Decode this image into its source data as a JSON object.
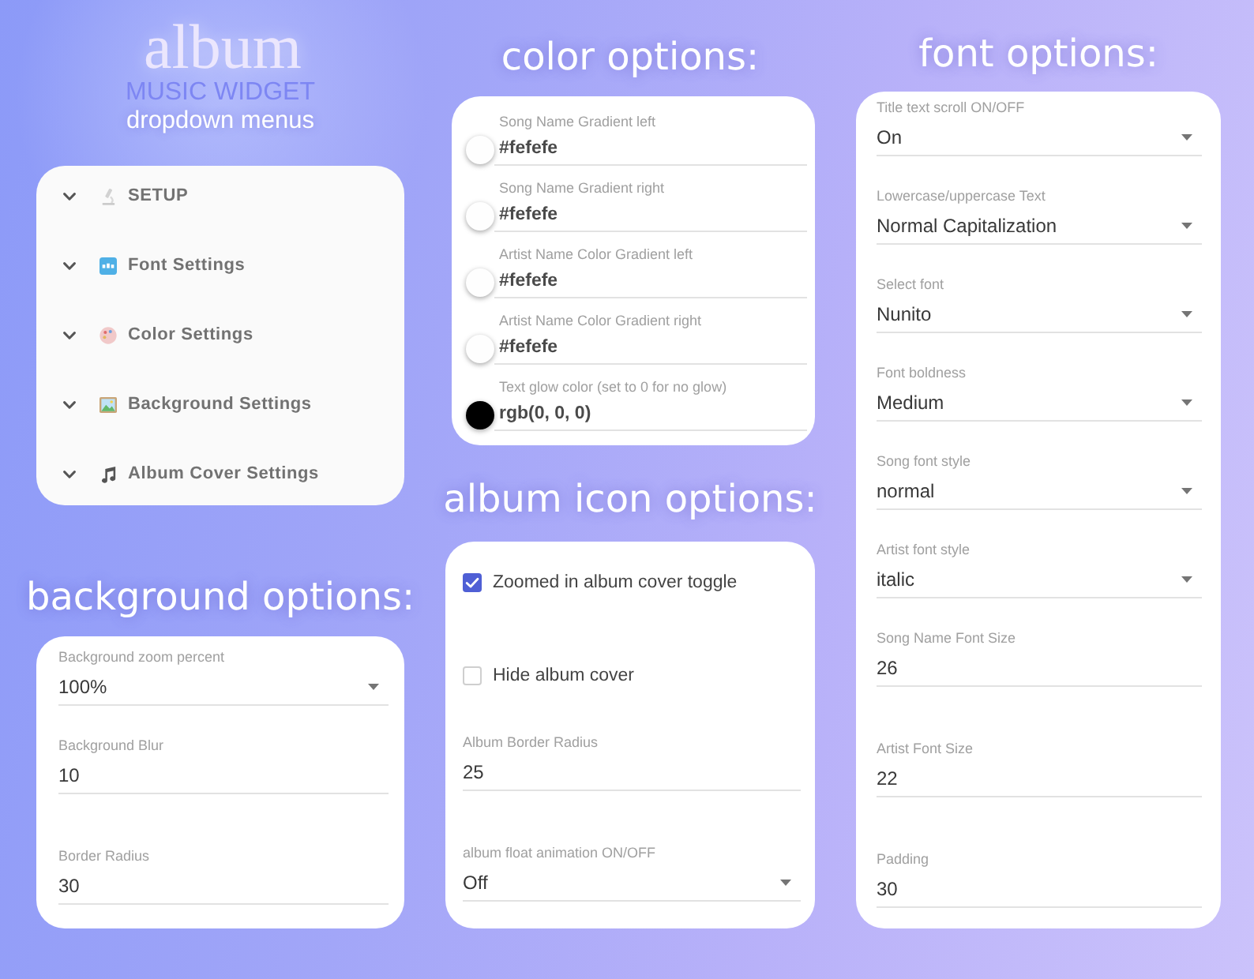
{
  "header": {
    "title": "album",
    "subtitle": "MUSIC WIDGET",
    "caption": "dropdown menus"
  },
  "setup_menu": {
    "items": [
      {
        "label": "SETUP",
        "expanded": false
      },
      {
        "label": "Font Settings",
        "expanded": false
      },
      {
        "label": "Color Settings",
        "expanded": false
      },
      {
        "label": "Background Settings",
        "expanded": false
      },
      {
        "label": "Album Cover Settings",
        "expanded": false
      }
    ]
  },
  "background_options": {
    "heading": "background options:",
    "fields": [
      {
        "kind": "select",
        "label": "Background zoom percent",
        "value": "100%"
      },
      {
        "kind": "number",
        "label": "Background Blur",
        "value": "10"
      },
      {
        "kind": "number",
        "label": "Border Radius",
        "value": "30"
      }
    ]
  },
  "color_options": {
    "heading": "color options:",
    "fields": [
      {
        "kind": "color",
        "label": "Song Name Gradient left",
        "value": "#fefefe",
        "color": "#fefefe"
      },
      {
        "kind": "color",
        "label": "Song Name Gradient right",
        "value": "#fefefe",
        "color": "#fefefe"
      },
      {
        "kind": "color",
        "label": "Artist Name Color Gradient left",
        "value": "#fefefe",
        "color": "#fefefe"
      },
      {
        "kind": "color",
        "label": "Artist Name Color Gradient right",
        "value": "#fefefe",
        "color": "#fefefe"
      },
      {
        "kind": "color",
        "label": "Text glow color (set to 0 for no glow)",
        "value": "rgb(0, 0, 0)",
        "color": "#000000"
      }
    ]
  },
  "album_icon_options": {
    "heading": "album icon options:",
    "fields": [
      {
        "kind": "checkbox",
        "label": "Zoomed in album cover toggle",
        "checked": true
      },
      {
        "kind": "checkbox",
        "label": "Hide album cover",
        "checked": false
      },
      {
        "kind": "number",
        "label": "Album Border Radius",
        "value": "25"
      },
      {
        "kind": "select",
        "label": "album float animation ON/OFF",
        "value": "Off"
      }
    ]
  },
  "font_options": {
    "heading": "font options:",
    "fields": [
      {
        "kind": "select",
        "label": "Title text scroll ON/OFF",
        "value": "On"
      },
      {
        "kind": "select",
        "label": "Lowercase/uppercase Text",
        "value": "Normal Capitalization"
      },
      {
        "kind": "select",
        "label": "Select font",
        "value": "Nunito"
      },
      {
        "kind": "select",
        "label": "Font boldness",
        "value": "Medium"
      },
      {
        "kind": "select",
        "label": "Song font style",
        "value": "normal"
      },
      {
        "kind": "select",
        "label": "Artist font style",
        "value": "italic"
      },
      {
        "kind": "number",
        "label": "Song Name Font Size",
        "value": "26"
      },
      {
        "kind": "number",
        "label": "Artist Font Size",
        "value": "22"
      },
      {
        "kind": "number",
        "label": "Padding",
        "value": "30"
      }
    ]
  }
}
